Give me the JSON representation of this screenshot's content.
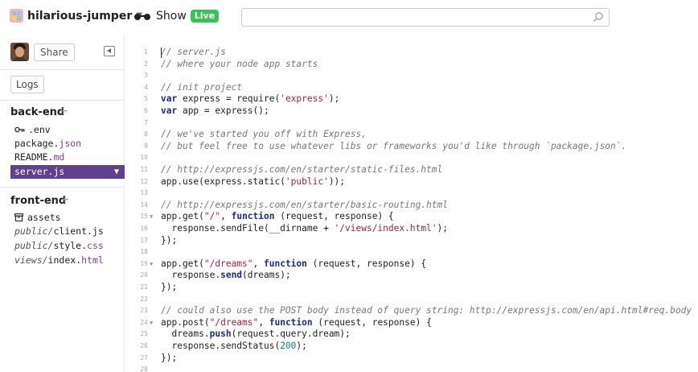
{
  "header": {
    "project_name": "hilarious-jumper",
    "show_label": "Show",
    "live_badge": "Live",
    "search_placeholder": ""
  },
  "sidebar": {
    "share_label": "Share",
    "logs_label": "Logs",
    "backend_title": "back-end",
    "frontend_title": "front-end",
    "plus": "+",
    "backend_files": [
      {
        "dir": "",
        "name": ".env",
        "ext": "",
        "icon": "key-icon",
        "selected": false
      },
      {
        "dir": "",
        "name": "package.",
        "ext": "json",
        "icon": "",
        "selected": false
      },
      {
        "dir": "",
        "name": "README.",
        "ext": "md",
        "icon": "",
        "selected": false
      },
      {
        "dir": "",
        "name": "server.js",
        "ext": "",
        "icon": "",
        "selected": true
      }
    ],
    "frontend_files": [
      {
        "dir": "",
        "name": "assets",
        "ext": "",
        "icon": "box-icon"
      },
      {
        "dir": "public/",
        "name": "client.js",
        "ext": ""
      },
      {
        "dir": "public/",
        "name": "style.",
        "ext": "css"
      },
      {
        "dir": "views/",
        "name": "index.",
        "ext": "html"
      }
    ]
  },
  "colors": {
    "selected_file_bg": "#5f418f",
    "live_badge": "#3cc05a",
    "keyword": "#1d2a8a",
    "string": "#a3233a",
    "comment": "#777777",
    "number": "#107d7d"
  },
  "editor": {
    "lines": [
      {
        "n": "1",
        "fold": false,
        "tokens": [
          [
            "comment",
            "// server.js"
          ]
        ]
      },
      {
        "n": "2",
        "fold": false,
        "tokens": [
          [
            "comment",
            "// where your node app starts"
          ]
        ]
      },
      {
        "n": "3",
        "fold": false,
        "tokens": []
      },
      {
        "n": "4",
        "fold": false,
        "tokens": [
          [
            "comment",
            "// init project"
          ]
        ]
      },
      {
        "n": "5",
        "fold": false,
        "tokens": [
          [
            "keyword",
            "var"
          ],
          [
            "plain",
            " express = require("
          ],
          [
            "string",
            "'express'"
          ],
          [
            "plain",
            ");"
          ]
        ]
      },
      {
        "n": "6",
        "fold": false,
        "tokens": [
          [
            "keyword",
            "var"
          ],
          [
            "plain",
            " app = express();"
          ]
        ]
      },
      {
        "n": "7",
        "fold": false,
        "tokens": []
      },
      {
        "n": "8",
        "fold": false,
        "tokens": [
          [
            "comment",
            "// we've started you off with Express,"
          ]
        ]
      },
      {
        "n": "9",
        "fold": false,
        "tokens": [
          [
            "comment",
            "// but feel free to use whatever libs or frameworks you'd like through `package.json`."
          ]
        ]
      },
      {
        "n": "10",
        "fold": false,
        "tokens": []
      },
      {
        "n": "11",
        "fold": false,
        "tokens": [
          [
            "comment",
            "// http://expressjs.com/en/starter/static-files.html"
          ]
        ]
      },
      {
        "n": "12",
        "fold": false,
        "tokens": [
          [
            "plain",
            "app.use(express.static("
          ],
          [
            "string",
            "'public'"
          ],
          [
            "plain",
            "));"
          ]
        ]
      },
      {
        "n": "13",
        "fold": false,
        "tokens": []
      },
      {
        "n": "14",
        "fold": false,
        "tokens": [
          [
            "comment",
            "// http://expressjs.com/en/starter/basic-routing.html"
          ]
        ]
      },
      {
        "n": "15",
        "fold": true,
        "tokens": [
          [
            "plain",
            "app.get("
          ],
          [
            "string",
            "\"/\""
          ],
          [
            "plain",
            ", "
          ],
          [
            "keyword",
            "function"
          ],
          [
            "plain",
            " (request, response) {"
          ]
        ]
      },
      {
        "n": "16",
        "fold": false,
        "tokens": [
          [
            "plain",
            "  response.sendFile(__dirname + "
          ],
          [
            "string",
            "'/views/index.html'"
          ],
          [
            "plain",
            ");"
          ]
        ]
      },
      {
        "n": "17",
        "fold": false,
        "tokens": [
          [
            "plain",
            "});"
          ]
        ]
      },
      {
        "n": "18",
        "fold": false,
        "tokens": []
      },
      {
        "n": "19",
        "fold": true,
        "tokens": [
          [
            "plain",
            "app.get("
          ],
          [
            "string",
            "\"/dreams\""
          ],
          [
            "plain",
            ", "
          ],
          [
            "keyword",
            "function"
          ],
          [
            "plain",
            " (request, response) {"
          ]
        ]
      },
      {
        "n": "20",
        "fold": false,
        "tokens": [
          [
            "plain",
            "  response."
          ],
          [
            "keyword",
            "send"
          ],
          [
            "plain",
            "(dreams);"
          ]
        ]
      },
      {
        "n": "21",
        "fold": false,
        "tokens": [
          [
            "plain",
            "});"
          ]
        ]
      },
      {
        "n": "22",
        "fold": false,
        "tokens": []
      },
      {
        "n": "23",
        "fold": false,
        "tokens": [
          [
            "comment",
            "// could also use the POST body instead of query string: http://expressjs.com/en/api.html#req.body"
          ]
        ]
      },
      {
        "n": "24",
        "fold": true,
        "tokens": [
          [
            "plain",
            "app.post("
          ],
          [
            "string",
            "\"/dreams\""
          ],
          [
            "plain",
            ", "
          ],
          [
            "keyword",
            "function"
          ],
          [
            "plain",
            " (request, response) {"
          ]
        ]
      },
      {
        "n": "25",
        "fold": false,
        "tokens": [
          [
            "plain",
            "  dreams."
          ],
          [
            "keyword",
            "push"
          ],
          [
            "plain",
            "(request.query.dream);"
          ]
        ]
      },
      {
        "n": "26",
        "fold": false,
        "tokens": [
          [
            "plain",
            "  response.sendStatus("
          ],
          [
            "number",
            "200"
          ],
          [
            "plain",
            ");"
          ]
        ]
      },
      {
        "n": "27",
        "fold": false,
        "tokens": [
          [
            "plain",
            "});"
          ]
        ]
      },
      {
        "n": "28",
        "fold": false,
        "tokens": []
      }
    ]
  }
}
